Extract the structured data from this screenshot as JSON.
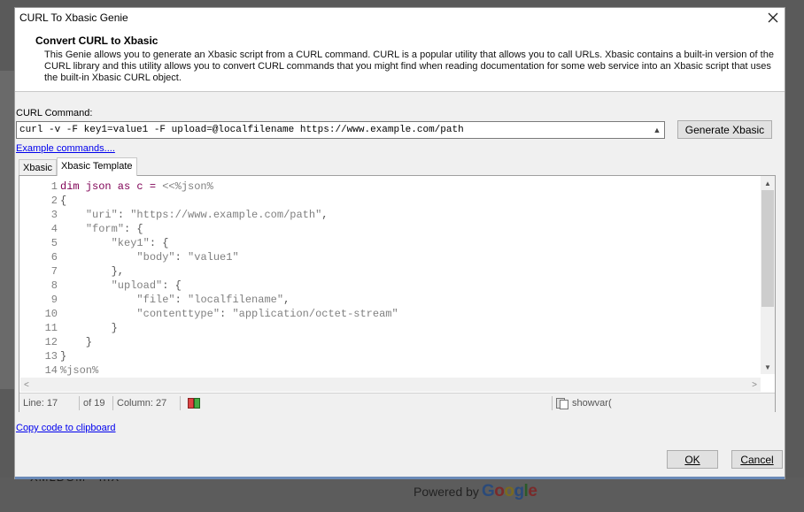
{
  "window": {
    "title": "CURL To Xbasic Genie"
  },
  "header": {
    "title": "Convert CURL to Xbasic",
    "description": "This Genie allows you to generate an Xbasic script from a CURL command. CURL is a popular utility that allows you to call URLs. Xbasic contains a built-in version of the CURL library and this utility allows you to convert CURL commands that you might find when reading documentation for some web service into an Xbasic script that uses the built-in Xbasic CURL object."
  },
  "command": {
    "label": "CURL Command:",
    "value": "curl -v -F key1=value1 -F upload=@localfilename https://www.example.com/path",
    "generate_label": "Generate Xbasic"
  },
  "links": {
    "examples": "Example commands....",
    "copy": "Copy code to clipboard"
  },
  "tabs": [
    {
      "label": "Xbasic"
    },
    {
      "label": "Xbasic Template"
    }
  ],
  "editor": {
    "lines": [
      {
        "n": "1",
        "parts": [
          [
            "kw",
            "dim json as c = "
          ],
          [
            "ctext",
            "<<%json%"
          ]
        ]
      },
      {
        "n": "2",
        "parts": [
          [
            "plain",
            "{"
          ]
        ]
      },
      {
        "n": "3",
        "parts": [
          [
            "plain",
            "    "
          ],
          [
            "str",
            "\"uri\""
          ],
          [
            "plain",
            ": "
          ],
          [
            "str",
            "\"https://www.example.com/path\""
          ],
          [
            "plain",
            ","
          ]
        ]
      },
      {
        "n": "4",
        "parts": [
          [
            "plain",
            "    "
          ],
          [
            "str",
            "\"form\""
          ],
          [
            "plain",
            ": {"
          ]
        ]
      },
      {
        "n": "5",
        "parts": [
          [
            "plain",
            "        "
          ],
          [
            "str",
            "\"key1\""
          ],
          [
            "plain",
            ": {"
          ]
        ]
      },
      {
        "n": "6",
        "parts": [
          [
            "plain",
            "            "
          ],
          [
            "str",
            "\"body\""
          ],
          [
            "plain",
            ": "
          ],
          [
            "str",
            "\"value1\""
          ]
        ]
      },
      {
        "n": "7",
        "parts": [
          [
            "plain",
            "        },"
          ]
        ]
      },
      {
        "n": "8",
        "parts": [
          [
            "plain",
            "        "
          ],
          [
            "str",
            "\"upload\""
          ],
          [
            "plain",
            ": {"
          ]
        ]
      },
      {
        "n": "9",
        "parts": [
          [
            "plain",
            "            "
          ],
          [
            "str",
            "\"file\""
          ],
          [
            "plain",
            ": "
          ],
          [
            "str",
            "\"localfilename\""
          ],
          [
            "plain",
            ","
          ]
        ]
      },
      {
        "n": "10",
        "parts": [
          [
            "plain",
            "            "
          ],
          [
            "str",
            "\"contenttype\""
          ],
          [
            "plain",
            ": "
          ],
          [
            "str",
            "\"application/octet-stream\""
          ]
        ]
      },
      {
        "n": "11",
        "parts": [
          [
            "plain",
            "        }"
          ]
        ]
      },
      {
        "n": "12",
        "parts": [
          [
            "plain",
            "    }"
          ]
        ]
      },
      {
        "n": "13",
        "parts": [
          [
            "plain",
            "}"
          ]
        ]
      },
      {
        "n": "14",
        "parts": [
          [
            "ctext",
            "%json%"
          ]
        ]
      }
    ]
  },
  "status": {
    "line": "Line: 17",
    "of": "of 19",
    "column": "Column: 27",
    "function": "showvar("
  },
  "buttons": {
    "ok": "OK",
    "cancel": "Cancel"
  },
  "background": {
    "bottom_text": "XMLDOM - IIIX",
    "powered_by": "Powered by",
    "google": [
      "G",
      "o",
      "o",
      "g",
      "l",
      "e"
    ]
  },
  "colors": {
    "keyword": "#7f0055",
    "string": "#808080",
    "link": "#0000ee",
    "accent": "#6a8ab8"
  },
  "icons": {
    "close": "close-icon",
    "book": "book-icon",
    "clipboard": "clipboard-icon"
  }
}
